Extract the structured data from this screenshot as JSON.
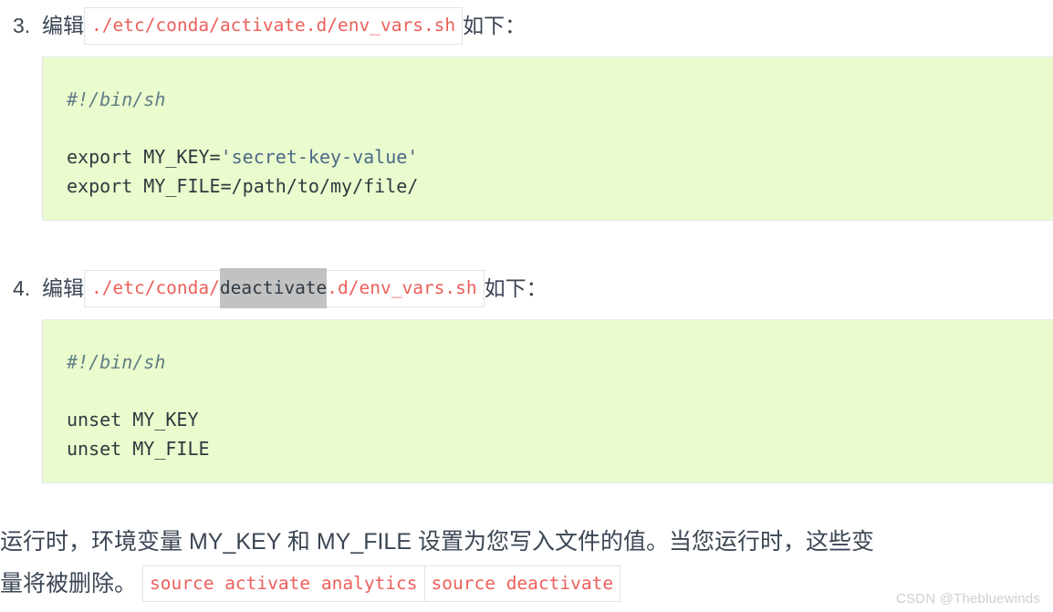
{
  "page": {
    "background": "#ffffff",
    "text_color": "#3b4654",
    "code_block_bg": "#eafbcd",
    "inline_code_color": "#ec5f5a",
    "comment_color": "#5f7d86",
    "string_color": "#4b6a89",
    "selection_bg": "#c2c2c2"
  },
  "steps": [
    {
      "marker": "3.",
      "lead_text": "编辑",
      "path_prefix": "./etc/conda/activate.d/env_vars.sh",
      "path_selected": "",
      "path_suffix": "",
      "trail_text": "如下："
    },
    {
      "marker": "4.",
      "lead_text": "编辑",
      "path_prefix": "./etc/conda/",
      "path_selected": "deactivate",
      "path_suffix": ".d/env_vars.sh",
      "trail_text": "如下："
    }
  ],
  "code_blocks": [
    {
      "name": "activate-script",
      "lines": [
        {
          "type": "comment",
          "text": "#!/bin/sh"
        },
        {
          "type": "spacer",
          "text": ""
        },
        {
          "type": "code",
          "pre": "export MY_KEY=",
          "string": "'secret-key-value'",
          "post": ""
        },
        {
          "type": "code",
          "pre": "export MY_FILE=/path/to/my/file/",
          "string": "",
          "post": ""
        }
      ]
    },
    {
      "name": "deactivate-script",
      "lines": [
        {
          "type": "comment",
          "text": "#!/bin/sh"
        },
        {
          "type": "spacer",
          "text": ""
        },
        {
          "type": "code",
          "pre": "unset MY_KEY",
          "string": "",
          "post": ""
        },
        {
          "type": "code",
          "pre": "unset MY_FILE",
          "string": "",
          "post": ""
        }
      ]
    }
  ],
  "closing": {
    "line1": "运行时，环境变量 MY_KEY 和 MY_FILE 设置为您写入文件的值。当您运行时，这些变",
    "line2_prefix": "量将被删除。",
    "code_a": "source activate analytics",
    "code_b": "source deactivate"
  },
  "watermark": {
    "text": "CSDN @Thebluewinds"
  }
}
